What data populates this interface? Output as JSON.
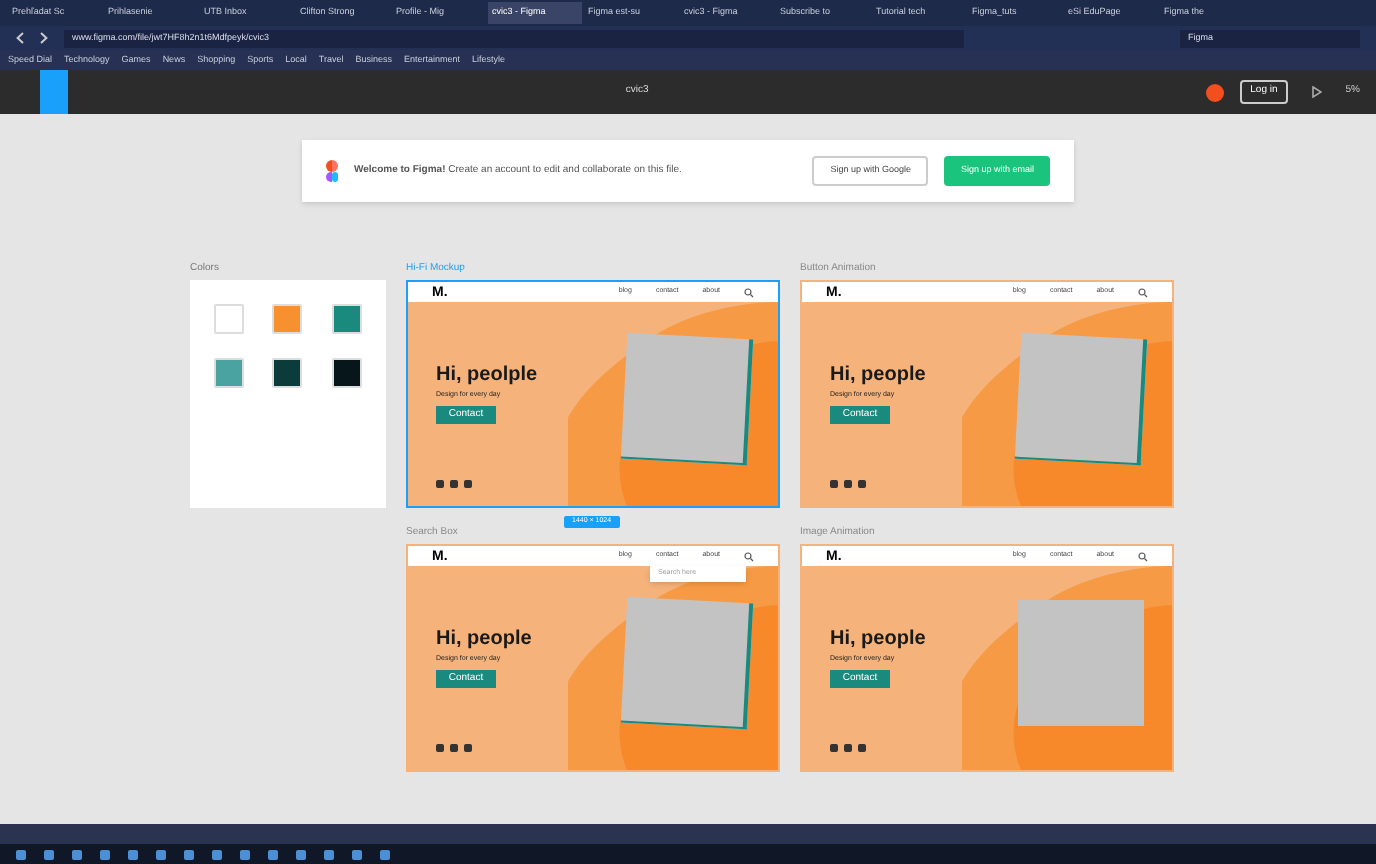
{
  "browser": {
    "tabs": [
      {
        "label": "Prehľadat Sc",
        "selected": false
      },
      {
        "label": "Prihlasenie",
        "selected": false
      },
      {
        "label": "UTB Inbox",
        "selected": false
      },
      {
        "label": "Clifton Strong",
        "selected": false
      },
      {
        "label": "Profile - Mig",
        "selected": false
      },
      {
        "label": "cvic3 - Figma",
        "selected": true
      },
      {
        "label": "Figma est-su",
        "selected": false
      },
      {
        "label": "cvic3 - Figma",
        "selected": false
      },
      {
        "label": "Subscribe to",
        "selected": false
      },
      {
        "label": "Tutorial tech",
        "selected": false
      },
      {
        "label": "Figma_tuts",
        "selected": false
      },
      {
        "label": "eSi EduPage",
        "selected": false
      },
      {
        "label": "Figma the",
        "selected": false
      }
    ],
    "url": "www.figma.com/file/jwt7HF8h2n1t6Mdfpeyk/cvic3",
    "search": "Figma",
    "bookmarks": [
      "Speed Dial",
      "Technology",
      "Games",
      "News",
      "Shopping",
      "Sports",
      "Local",
      "Travel",
      "Business",
      "Entertainment",
      "Lifestyle"
    ]
  },
  "figma": {
    "file_name": "cvic3",
    "login": "Log in",
    "zoom": "5%"
  },
  "banner": {
    "message": "**Welcome to Figma!** Create an account to edit and collaborate on this file.",
    "google_button": "Sign up with Google",
    "email_button": "Sign up with email"
  },
  "colors_panel": {
    "label": "Colors",
    "swatches": [
      {
        "color": "#ffffff"
      },
      {
        "color": "#f7902e"
      },
      {
        "color": "#1b8a7e"
      },
      {
        "color": "#4aa3a0"
      },
      {
        "color": "#0b3b3a"
      },
      {
        "color": "#06161a"
      }
    ]
  },
  "frames": [
    {
      "label": "Hi-Fi Mockup",
      "selected": true,
      "size_badge": "1440 × 1024",
      "logo": "M.",
      "nav": [
        "blog",
        "contact",
        "about"
      ],
      "heading": "Hi, peolple",
      "subtitle": "Design for every day",
      "button": "Contact",
      "tilted": true
    },
    {
      "label": "Button Animation",
      "selected": false,
      "logo": "M.",
      "nav": [
        "blog",
        "contact",
        "about"
      ],
      "heading": "Hi, people",
      "subtitle": "Design for every day",
      "button": "Contact",
      "tilted": true
    },
    {
      "label": "Search Box",
      "selected": false,
      "logo": "M.",
      "nav": [
        "blog",
        "contact",
        "about"
      ],
      "heading": "Hi, people",
      "subtitle": "Design for every day",
      "button": "Contact",
      "tilted": true,
      "dropdown": "Search here"
    },
    {
      "label": "Image Animation",
      "selected": false,
      "logo": "M.",
      "nav": [
        "blog",
        "contact",
        "about"
      ],
      "heading": "Hi, people",
      "subtitle": "Design for every day",
      "button": "Contact",
      "tilted": false
    }
  ]
}
